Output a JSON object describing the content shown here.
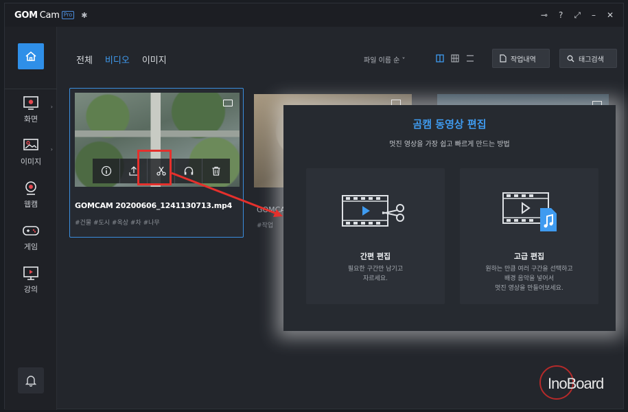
{
  "app": {
    "brand": "GOM",
    "brand_suffix": "Cam",
    "badge": "Pro",
    "window_controls": [
      "?",
      "⤢",
      "–",
      "✕"
    ]
  },
  "sidebar": {
    "items": [
      {
        "label": "화면",
        "icon": "screen-record-icon"
      },
      {
        "label": "이미지",
        "icon": "image-icon"
      },
      {
        "label": "웹캠",
        "icon": "webcam-icon"
      },
      {
        "label": "게임",
        "icon": "gamepad-icon"
      },
      {
        "label": "강의",
        "icon": "lecture-icon"
      }
    ]
  },
  "header": {
    "tabs": [
      {
        "label": "전체",
        "active": false
      },
      {
        "label": "비디오",
        "active": true
      },
      {
        "label": "이미지",
        "active": false
      }
    ],
    "sort_label": "파일 이름 순",
    "history_button": "작업내역",
    "tag_search_button": "태그검색"
  },
  "cards": [
    {
      "filename": "GOMCAM 20200606_1241130713.mp4",
      "tags": "#건물 #도시 #옥상 #차 #나무",
      "actions": [
        "info-icon",
        "share-icon",
        "scissors-icon",
        "headphones-icon",
        "trash-icon"
      ]
    },
    {
      "filename": "GOMCA",
      "tags": "#작업"
    }
  ],
  "modal": {
    "title": "곰캠 동영상 편집",
    "subtitle": "멋진 영상을 가장 쉽고 빠르게 만드는 방법",
    "options": [
      {
        "title": "간편 편집",
        "desc_line1": "필요한 구간만 남기고",
        "desc_line2": "자르세요."
      },
      {
        "title": "고급 편집",
        "desc_line1": "원하는 만큼 여러 구간을 선택하고",
        "desc_line2": "배경 음악을 넣어서",
        "desc_line3": "멋진 영상을 만들어보세요."
      }
    ]
  },
  "watermark": "InoBoard",
  "colors": {
    "accent": "#3f9bf0",
    "highlight": "#e5302c",
    "bg": "#23262c"
  }
}
